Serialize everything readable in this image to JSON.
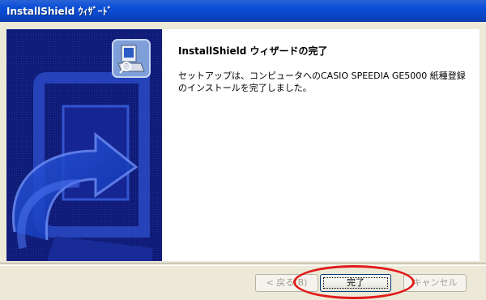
{
  "window": {
    "title": "InstallShield ｳｨｻﾞｰﾄﾞ"
  },
  "content": {
    "heading": "InstallShield ウィザードの完了",
    "message": "セットアップは、コンピュータへのCASIO SPEEDIA GE5000 紙種登録\nのインストールを完了しました。"
  },
  "buttons": {
    "back_label": "< 戻る(B)",
    "finish_label": "完了",
    "cancel_label": "キャンセル"
  },
  "colors": {
    "titlebar": "#0b4fd8",
    "left_panel": "#0f1b76",
    "annotation": "#e11a1a"
  }
}
